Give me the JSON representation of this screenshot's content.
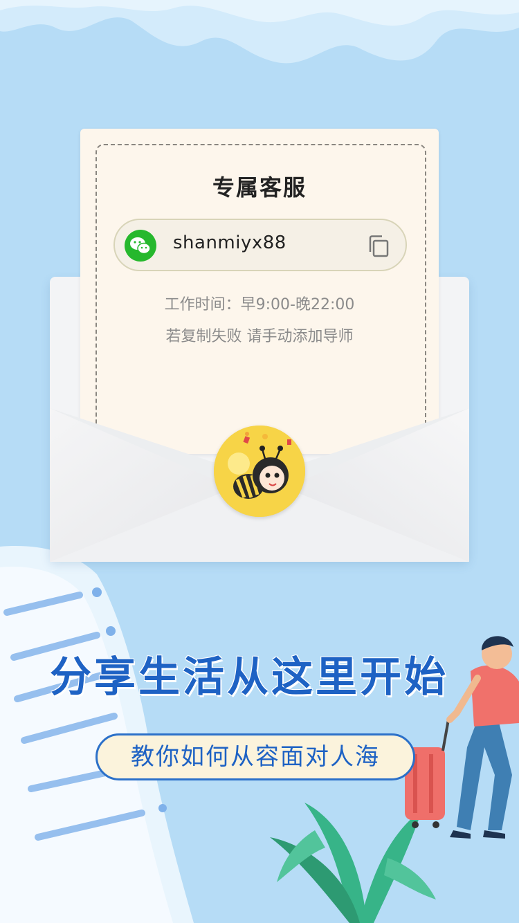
{
  "card": {
    "title": "专属客服",
    "wechat_id": "shanmiyx88",
    "hours": "工作时间：早9:00-晚22:00",
    "copy_fail_hint": "若复制失败 请手动添加导师"
  },
  "promo": {
    "headline": "分享生活从这里开始",
    "subheadline": "教你如何从容面对人海"
  },
  "colors": {
    "background": "#b6dcf6",
    "headline": "#1e62c4",
    "wechat_green": "#26b82d",
    "card": "#fdf6ec"
  },
  "icons": {
    "wechat": "wechat-icon",
    "copy": "copy-icon",
    "avatar": "bee-avatar"
  }
}
